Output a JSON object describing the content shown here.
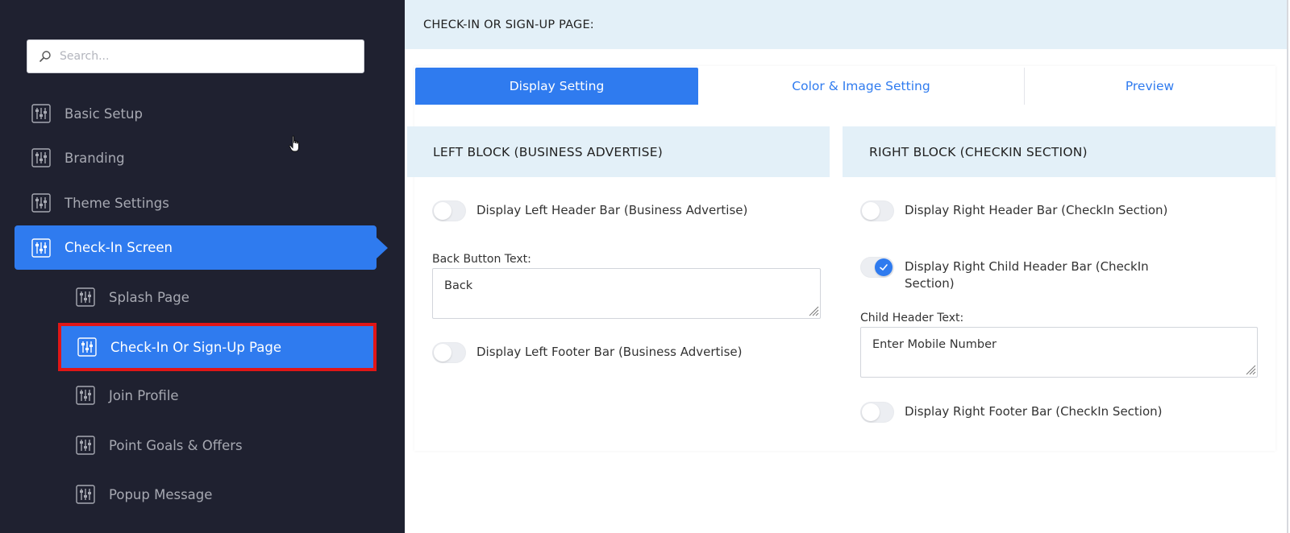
{
  "sidebar": {
    "search_placeholder": "Search...",
    "items": [
      {
        "label": "Basic Setup"
      },
      {
        "label": "Branding"
      },
      {
        "label": "Theme Settings"
      },
      {
        "label": "Check-In Screen"
      }
    ],
    "subitems": [
      {
        "label": "Splash Page"
      },
      {
        "label": "Check-In Or Sign-Up Page"
      },
      {
        "label": "Join Profile"
      },
      {
        "label": "Point Goals & Offers"
      },
      {
        "label": "Popup Message"
      }
    ]
  },
  "main": {
    "page_title": "CHECK-IN OR SIGN-UP PAGE:",
    "tabs": [
      {
        "label": "Display Setting"
      },
      {
        "label": "Color & Image Setting"
      },
      {
        "label": "Preview"
      }
    ],
    "left_block": {
      "title": "LEFT BLOCK (BUSINESS ADVERTISE)",
      "header_toggle_label": "Display Left Header Bar (Business Advertise)",
      "header_toggle_on": false,
      "back_button_label": "Back Button Text:",
      "back_button_value": "Back",
      "footer_toggle_label": "Display Left Footer Bar (Business Advertise)",
      "footer_toggle_on": false
    },
    "right_block": {
      "title": "RIGHT BLOCK (CHECKIN SECTION)",
      "header_toggle_label": "Display Right Header Bar (CheckIn Section)",
      "header_toggle_on": false,
      "child_header_toggle_label_line1": "Display Right Child Header Bar (CheckIn",
      "child_header_toggle_label_line2": "Section)",
      "child_header_toggle_on": true,
      "child_header_label": "Child Header Text:",
      "child_header_value": "Enter Mobile Number",
      "footer_toggle_label": "Display Right Footer Bar (CheckIn Section)",
      "footer_toggle_on": false
    }
  },
  "colors": {
    "sidebar_bg": "#1f2130",
    "accent": "#2f7bef",
    "highlight_border": "#e01616",
    "section_bg": "#e3f0f8"
  }
}
